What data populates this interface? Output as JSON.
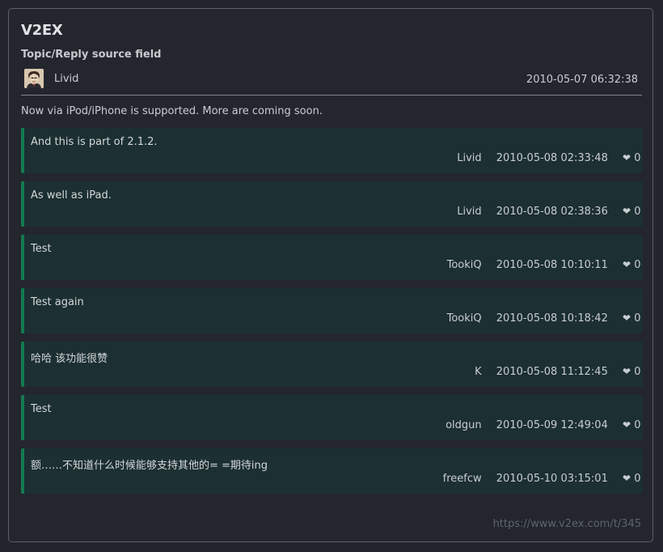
{
  "site": {
    "title": "V2EX"
  },
  "topic": {
    "field_label": "Topic/Reply source field",
    "author": "Livid",
    "created": "2010-05-07 06:32:38",
    "content": "Now via iPod/iPhone is supported. More are coming soon."
  },
  "replies": [
    {
      "text": "And this is part of 2.1.2.",
      "author": "Livid",
      "time": "2010-05-08 02:33:48",
      "likes": "0"
    },
    {
      "text": "As well as iPad.",
      "author": "Livid",
      "time": "2010-05-08 02:38:36",
      "likes": "0"
    },
    {
      "text": "Test",
      "author": "TookiQ",
      "time": "2010-05-08 10:10:11",
      "likes": "0"
    },
    {
      "text": "Test again",
      "author": "TookiQ",
      "time": "2010-05-08 10:18:42",
      "likes": "0"
    },
    {
      "text": "哈哈 该功能很赞",
      "author": "K",
      "time": "2010-05-08 11:12:45",
      "likes": "0"
    },
    {
      "text": "Test",
      "author": "oldgun",
      "time": "2010-05-09 12:49:04",
      "likes": "0"
    },
    {
      "text": "额……不知道什么时候能够支持其他的= =期待ing",
      "author": "freefcw",
      "time": "2010-05-10 03:15:01",
      "likes": "0"
    }
  ],
  "icons": {
    "like": "heart-icon",
    "avatar": "avatar-portrait"
  },
  "colors": {
    "accent": "#147a50",
    "reply_bg": "#1c2f31",
    "background": "#23262d"
  },
  "footer": {
    "url": "https://www.v2ex.com/t/345"
  }
}
